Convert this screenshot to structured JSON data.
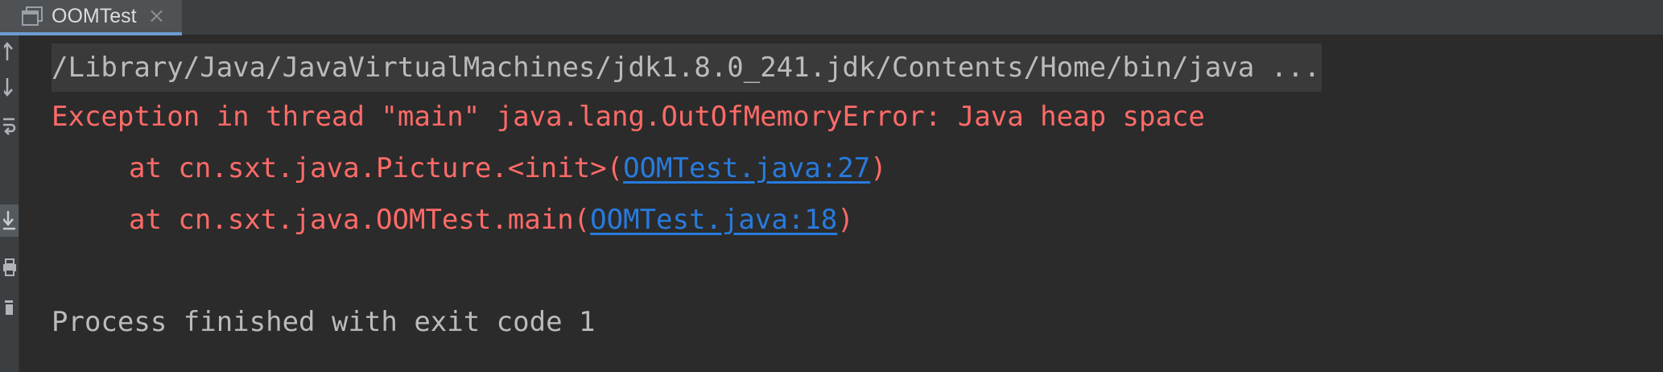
{
  "tab": {
    "title": "OOMTest",
    "close_glyph": "×",
    "icon": "console-window-icon"
  },
  "gutter": {
    "buttons": [
      {
        "icon": "arrow-up-icon"
      },
      {
        "icon": "arrow-down-icon"
      },
      {
        "icon": "soft-wrap-icon"
      },
      {
        "icon": "scroll-to-end-icon",
        "active": true
      },
      {
        "icon": "print-icon"
      },
      {
        "icon": "trash-icon"
      }
    ]
  },
  "console": {
    "command": "/Library/Java/JavaVirtualMachines/jdk1.8.0_241.jdk/Contents/Home/bin/java ...",
    "exception": "Exception in thread \"main\" java.lang.OutOfMemoryError: Java heap space",
    "stack": [
      {
        "prefix": "at cn.sxt.java.Picture.<init>(",
        "link": "OOMTest.java:27",
        "suffix": ")"
      },
      {
        "prefix": "at cn.sxt.java.OOMTest.main(",
        "link": "OOMTest.java:18",
        "suffix": ")"
      }
    ],
    "exit_message": "Process finished with exit code 1"
  },
  "colors": {
    "background": "#2b2b2b",
    "error_text": "#ff6b68",
    "normal_text": "#bbbbbb",
    "link": "#287bde"
  }
}
